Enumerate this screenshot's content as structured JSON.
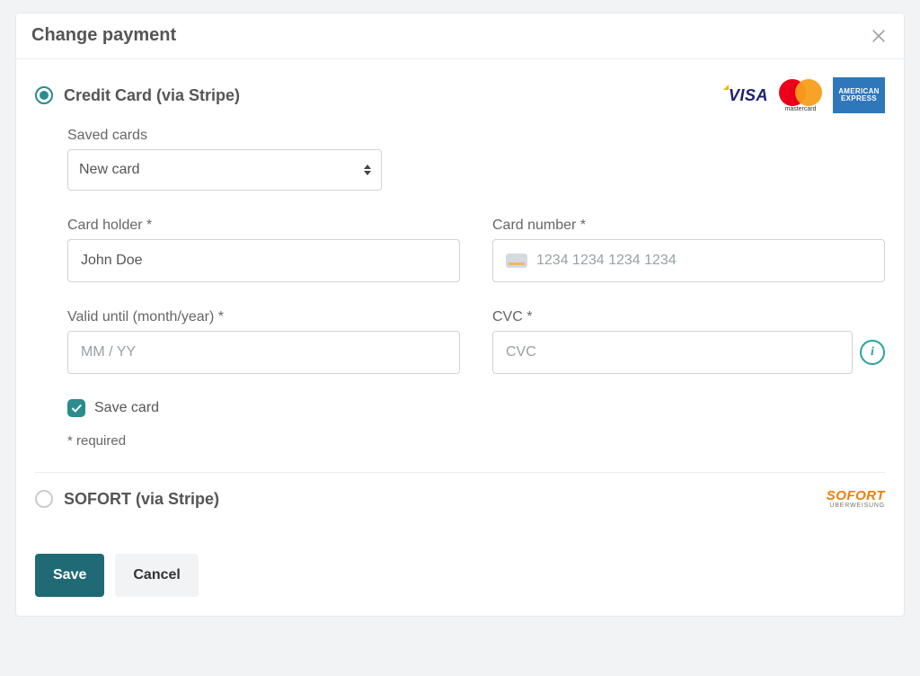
{
  "modal": {
    "title": "Change payment"
  },
  "payment_methods": {
    "credit_card": {
      "label": "Credit Card (via Stripe)",
      "selected": true,
      "saved_cards": {
        "label": "Saved cards",
        "selected": "New card"
      },
      "card_holder": {
        "label": "Card holder *",
        "value": "John Doe"
      },
      "card_number": {
        "label": "Card number *",
        "placeholder": "1234 1234 1234 1234"
      },
      "valid_until": {
        "label": "Valid until (month/year) *",
        "placeholder": "MM / YY"
      },
      "cvc": {
        "label": "CVC *",
        "placeholder": "CVC"
      },
      "save_card": {
        "label": "Save card",
        "checked": true
      },
      "required_note": "* required",
      "logos": {
        "visa": "VISA",
        "mastercard_caption": "mastercard",
        "amex_line1": "AMERICAN",
        "amex_line2": "EXPRESS"
      }
    },
    "sofort": {
      "label": "SOFORT (via Stripe)",
      "selected": false,
      "logo_top": "SOFORT",
      "logo_sub": "ÜBERWEISUNG"
    }
  },
  "footer": {
    "save": "Save",
    "cancel": "Cancel"
  }
}
